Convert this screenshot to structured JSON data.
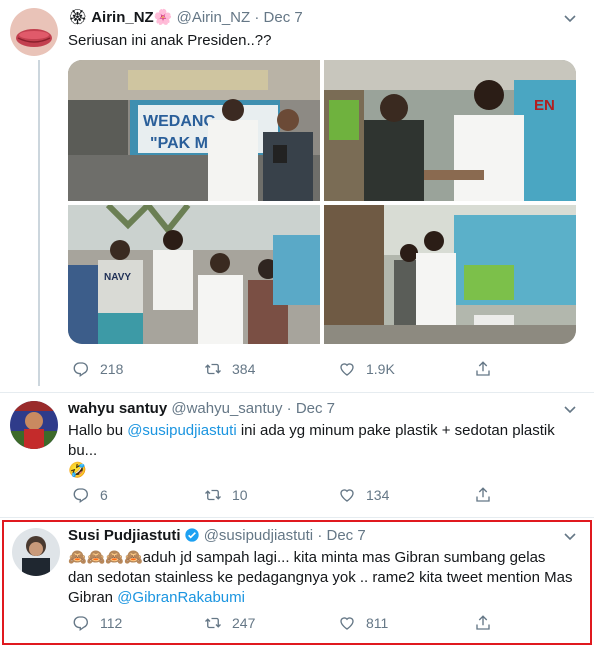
{
  "tweets": [
    {
      "name": "Airin_NZ",
      "name_emoji_left": "🏵",
      "name_emoji_right": "🌸",
      "handle": "@Airin_NZ",
      "dot": "·",
      "date": "Dec 7",
      "text": "Seriusan ini anak Presiden..??",
      "replies": "218",
      "retweets": "384",
      "likes": "1.9K"
    },
    {
      "name": "wahyu santuy",
      "handle": "@wahyu_santuy",
      "dot": "·",
      "date": "Dec 7",
      "text_before": "Hallo bu ",
      "mention": "@susipudjiastuti",
      "text_after": " ini ada yg minum pake plastik + sedotan plastik bu...",
      "emoji": "🤣",
      "replies": "6",
      "retweets": "10",
      "likes": "134"
    },
    {
      "name": "Susi Pudjiastuti",
      "handle": "@susipudjiastuti",
      "dot": "·",
      "date": "Dec 7",
      "emoji": "🙈🙈🙈🙈",
      "text_before": "aduh jd sampah lagi... kita minta mas Gibran sumbang gelas dan sedotan stainless ke pedagangnya yok .. rame2 kita tweet mention Mas Gibran ",
      "mention": "@GibranRakabumi",
      "replies": "112",
      "retweets": "247",
      "likes": "811"
    }
  ],
  "photo_signs": {
    "sign1_line1": "WEDANG",
    "sign1_line2": "\"PAK M",
    "sign2": "EN",
    "shirt": "NAVY"
  },
  "colors": {
    "accent": "#1b95e0",
    "highlight": "#e0191f",
    "muted": "#657786"
  }
}
